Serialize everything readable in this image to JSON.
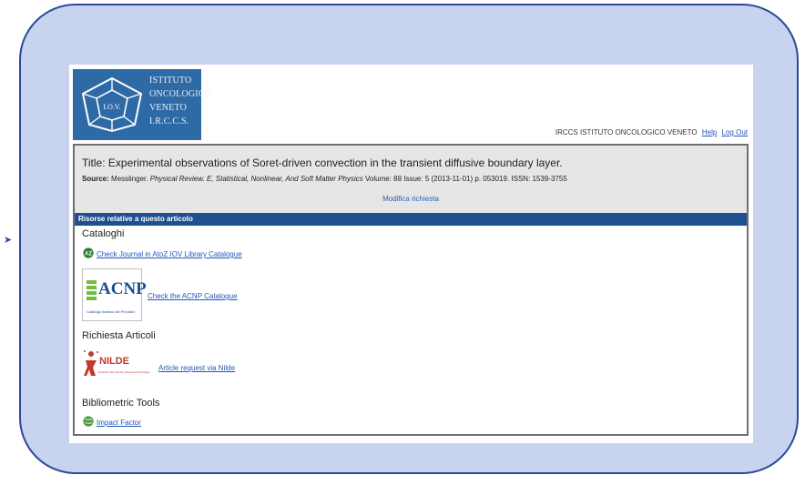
{
  "logo": {
    "lines": [
      "ISTITUTO",
      "ONCOLOGICO",
      "VENETO",
      "I.R.C.C.S."
    ],
    "emblem_text": "I.O.V."
  },
  "header": {
    "org": "IRCCS ISTITUTO ONCOLOGICO VENETO",
    "help": "Help",
    "logout": "Log Out"
  },
  "citation": {
    "title_label": "Title:",
    "title": "Experimental observations of Soret-driven convection in the transient diffusive boundary layer.",
    "source_label": "Source:",
    "source_author": "Messlinger.",
    "source_journal": "Physical Review. E, Statistical, Nonlinear, And Soft Matter Physics",
    "source_details": "Volume: 88 Issue: 5 (2013-11-01) p. 053019. ISSN: 1539-3755",
    "modify": "Modifica richiesta"
  },
  "resources": {
    "bar": "Risorse relative a questo articolo",
    "catalogs": {
      "heading": "Cataloghi",
      "atoz_icon_text": "AZ",
      "atoz_link": "Check Journal in AtoZ IOV Library Catalogue",
      "acnp_logo": "ACNP",
      "acnp_sub": "Catalogo Italiano dei Periodici",
      "acnp_link": "Check the ACNP Catalogue"
    },
    "requests": {
      "heading": "Richiesta Articoli",
      "nilde_logo": "NILDE",
      "nilde_sub": "Network Inter-Library Document Exchange",
      "nilde_link": "Article request via Nilde"
    },
    "bibliometric": {
      "heading": "Bibliometric Tools",
      "impact_link": "Impact Factor"
    }
  },
  "colors": {
    "frame_fill": "#c7d3ef",
    "frame_border": "#2b4a96",
    "logo_blue": "#2e6aa6",
    "bar_blue": "#1f4f8f",
    "link": "#2255bb"
  }
}
